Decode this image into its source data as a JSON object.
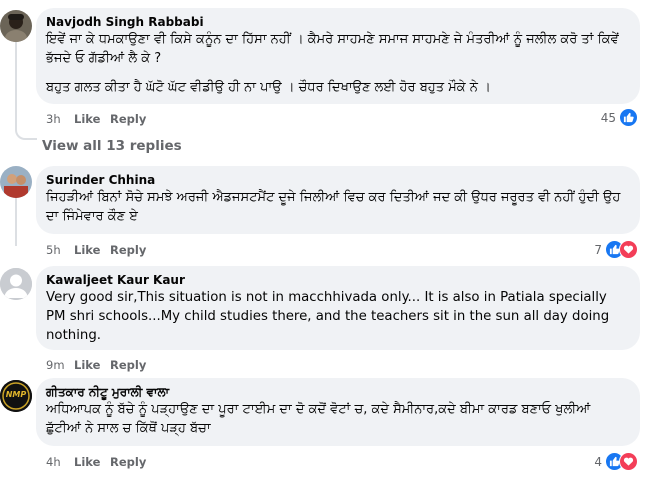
{
  "colors": {
    "bubble": "#f0f2f5",
    "meta": "#65676b",
    "like_blue": "#1877f2",
    "love_red": "#f33e58"
  },
  "comments": [
    {
      "author": "Navjodh Singh Rabbabi",
      "paragraphs": [
        "ਇਵੇਂ ਜਾ ਕੇ ਧਮਕਾਉਣਾ ਵੀ ਕਿਸੇ ਕਨੂੰਨ ਦਾ ਹਿੱਸਾ ਨਹੀਂ । ਕੈਮਰੇ ਸਾਹਮਣੇ ਸਮਾਜ ਸਾਹਮਣੇ ਜੇ ਮੰਤਰੀਆਂ ਨੂੰ ਜਲੀਲ ਕਰੋ ਤਾਂ ਕਿਵੇਂ ਭੱਜਦੇ ਓ ਗੱਡੀਆਂ ਲੈ ਕੇ ?",
        "ਬਹੁਤ ਗਲਤ ਕੀਤਾ ਹੈ ਘੱਟੋ ਘੱਟ ਵੀਡੀਉ ਹੀ ਨਾ ਪਾਉ । ਚੌਧਰ ਦਿਖਾਉਣ ਲਈ ਹੋਰ ਬਹੁਤ ਮੌਕੇ ਨੇ ।"
      ],
      "time": "3h",
      "like_label": "Like",
      "reply_label": "Reply",
      "reaction_count": "45",
      "reactions": [
        "like-icon"
      ]
    },
    {
      "author": "Surinder Chhina",
      "paragraphs": [
        "ਜਿਹੜੀਆਂ ਬਿਨਾਂ ਸੋਚੇ ਸਮਝੇ ਅਰਜੀ ਐਡਜਸਟਮੈਂਟ ਦੂਜੇ ਜਿਲੀਆਂ ਵਿਚ ਕਰ ਦਿਤੀਆਂ ਜਦ ਕੀ ਉਧਰ ਜਰੂਰਤ ਵੀ ਨਹੀਂ ਹੁੰਦੀ ਉਹ ਦਾ ਜਿੰਮੇਵਾਰ ਕੌਣ ਏ"
      ],
      "time": "5h",
      "like_label": "Like",
      "reply_label": "Reply",
      "reaction_count": "7",
      "reactions": [
        "like-icon",
        "love-icon"
      ]
    },
    {
      "author": "Kawaljeet Kaur Kaur",
      "paragraphs": [
        "Very good sir,This situation is not in macchhivada only... It is also in Patiala specially PM shri schools...My child studies there, and the teachers sit in the sun all day doing nothing."
      ],
      "time": "9m",
      "like_label": "Like",
      "reply_label": "Reply",
      "reaction_count": "",
      "reactions": []
    },
    {
      "author": "ਗੀਤਕਾਰ ਨੀਟੂ ਮੁਰਾਲੀ ਵਾਲਾ",
      "avatar_text": "NMP",
      "paragraphs": [
        "ਅਧਿਆਪਕ ਨੂੰ ਬੱਚੇ ਨੂੰ ਪੜ੍ਹਾਉਣ ਦਾ ਪੂਰਾ ਟਾਈਮ ਦਾ ਦੋ ਕਦੋਂ ਵੋਟਾਂ ਚ, ਕਦੇ ਸੈਮੀਨਾਰ,ਕਦੇ ਬੀਮਾ ਕਾਰਡ ਬਣਾਓ ਖੁਲੀਆਂ ਛੁੱਟੀਆਂ ਨੇ ਸਾਲ ਚ ਕਿੱਥੋਂ ਪੜ੍ਹ ਬੱਚਾ"
      ],
      "time": "4h",
      "like_label": "Like",
      "reply_label": "Reply",
      "reaction_count": "4",
      "reactions": [
        "like-icon",
        "love-icon"
      ]
    }
  ],
  "view_replies": "View all 13 replies"
}
